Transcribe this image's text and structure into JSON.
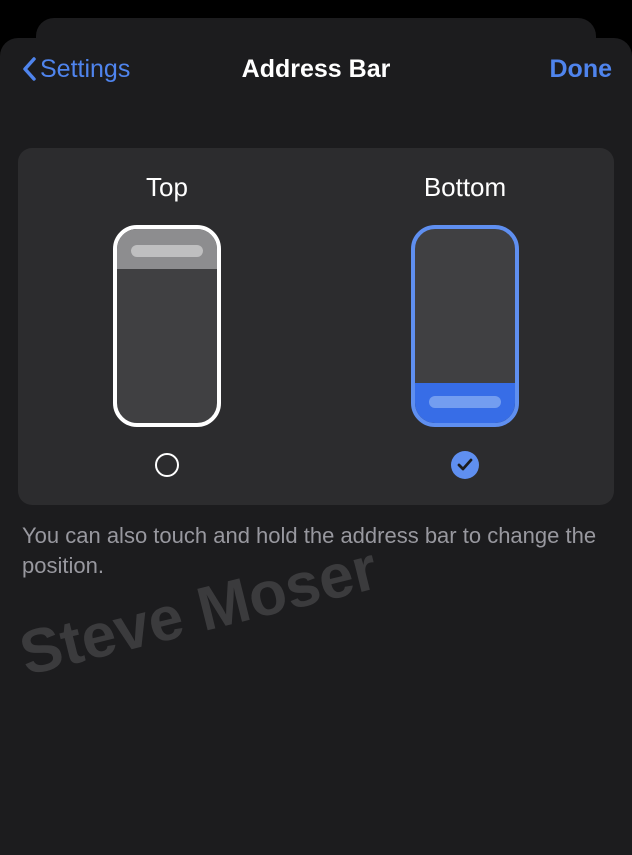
{
  "nav": {
    "back_label": "Settings",
    "title": "Address Bar",
    "done_label": "Done"
  },
  "options": {
    "top": {
      "label": "Top",
      "selected": false
    },
    "bottom": {
      "label": "Bottom",
      "selected": true
    }
  },
  "footer": "You can also touch and hold the address bar to change the position.",
  "watermark": "Steve Moser",
  "colors": {
    "accent": "#5f8ff0",
    "panel": "#2c2c2e",
    "background": "#1c1c1e",
    "text_secondary": "#98989f"
  }
}
